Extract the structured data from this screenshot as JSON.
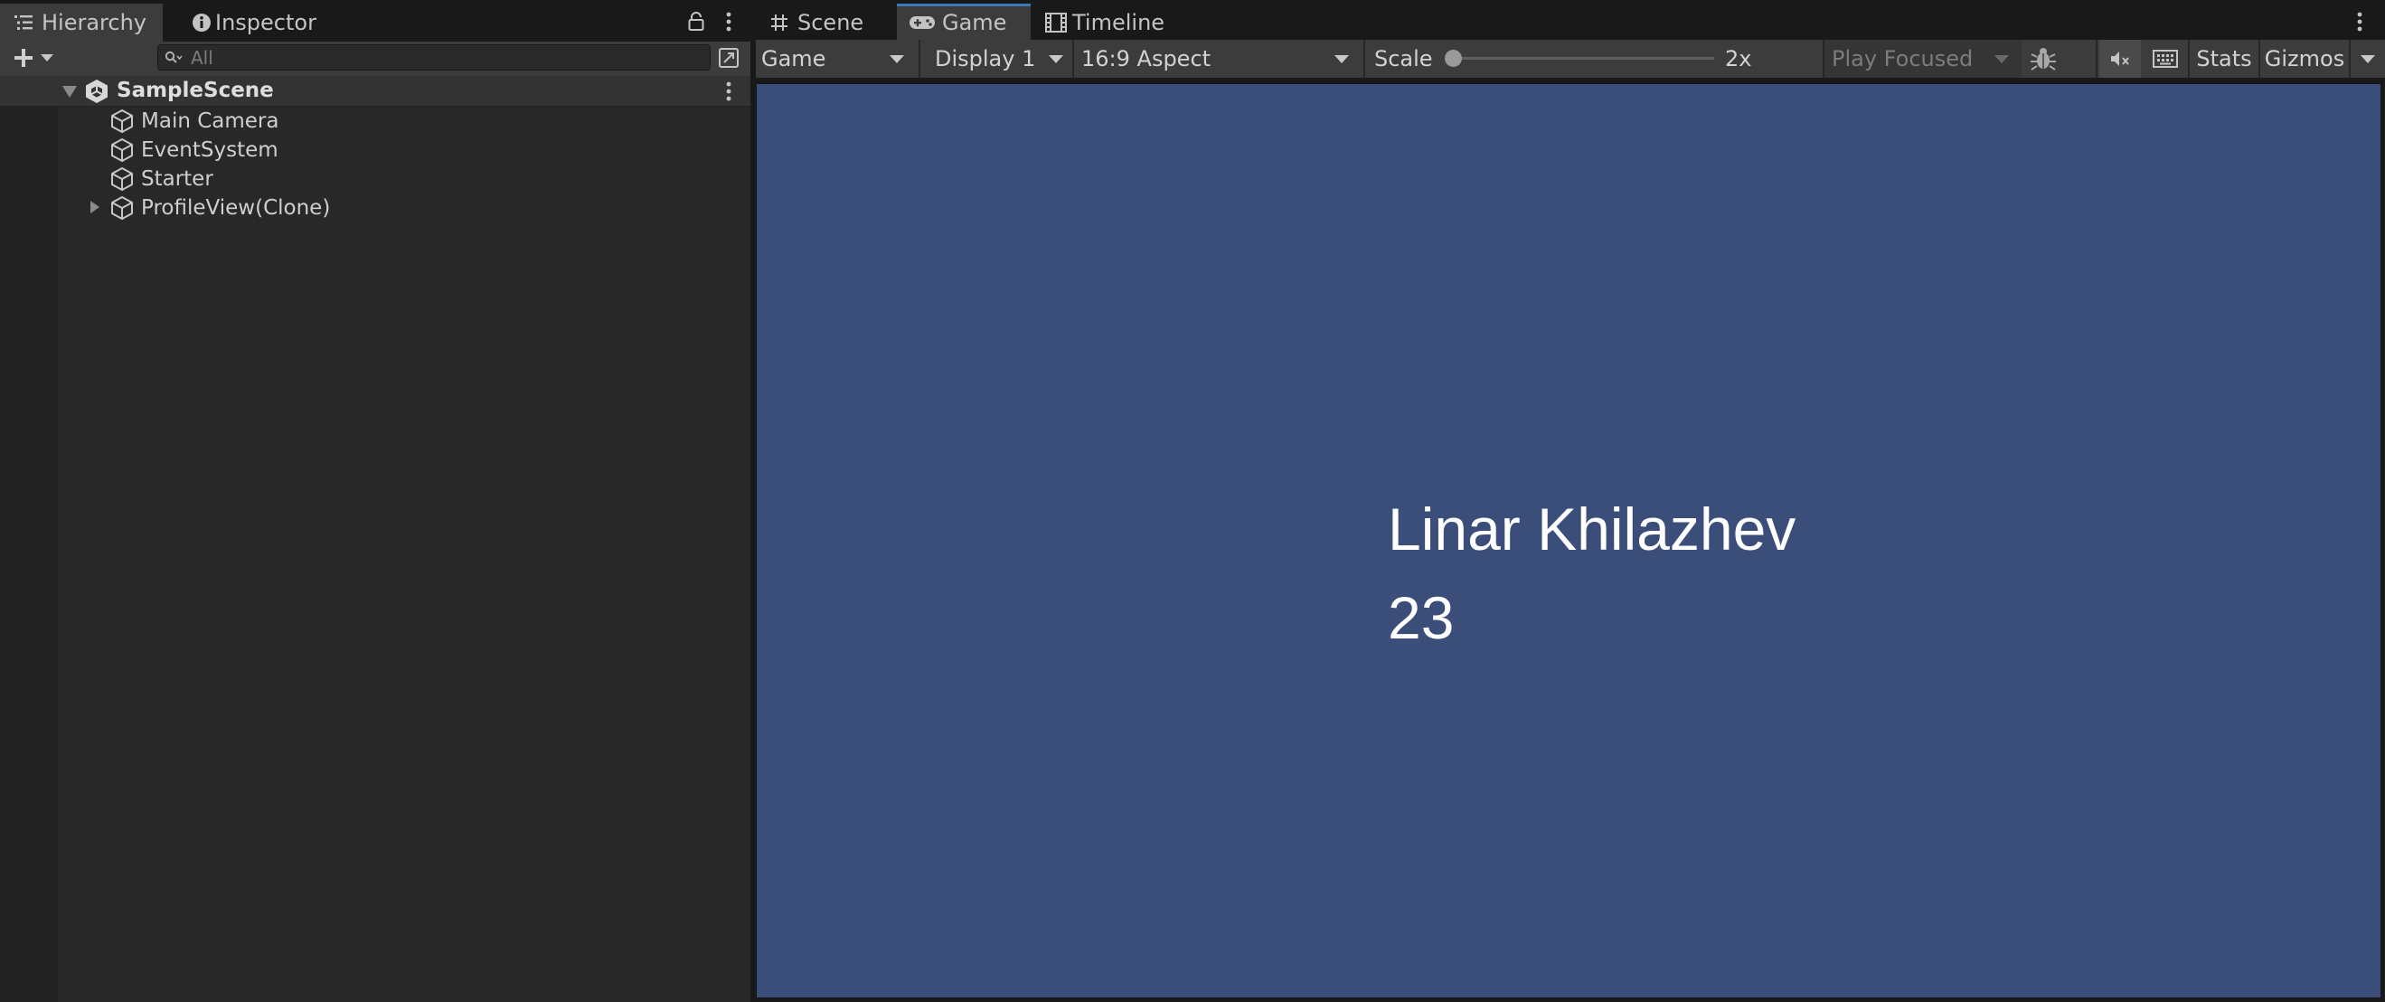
{
  "hierarchy_panel": {
    "tabs": [
      {
        "label": "Hierarchy",
        "icon": "hierarchy-list-icon"
      },
      {
        "label": "Inspector",
        "icon": "info-icon"
      }
    ],
    "search": {
      "placeholder": "All"
    },
    "scene": {
      "name": "SampleScene"
    },
    "items": [
      {
        "label": "Main Camera",
        "icon": "gameobject-cube-icon"
      },
      {
        "label": "EventSystem",
        "icon": "gameobject-cube-icon"
      },
      {
        "label": "Starter",
        "icon": "gameobject-cube-icon"
      },
      {
        "label": "ProfileView(Clone)",
        "icon": "gameobject-cube-icon",
        "collapsed": true
      }
    ]
  },
  "game_panel": {
    "tabs": [
      {
        "label": "Scene",
        "icon": "grid-hash-icon"
      },
      {
        "label": "Game",
        "icon": "gamepad-icon",
        "active": true
      },
      {
        "label": "Timeline",
        "icon": "film-icon"
      }
    ],
    "toolbar": {
      "view_mode": "Game",
      "display": "Display 1",
      "aspect": "16:9 Aspect",
      "scale_label": "Scale",
      "scale_value": "2x",
      "play_mode": "Play Focused",
      "stats_label": "Stats",
      "gizmos_label": "Gizmos"
    },
    "viewport": {
      "name": "Linar Khilazhev",
      "age": "23",
      "background_color": "#3a4e79"
    }
  },
  "colors": {
    "panel_bg": "#282828",
    "toolbar_bg": "#3c3c3c",
    "tabbar_bg": "#191919",
    "active_tab_accent": "#3a79bb"
  }
}
